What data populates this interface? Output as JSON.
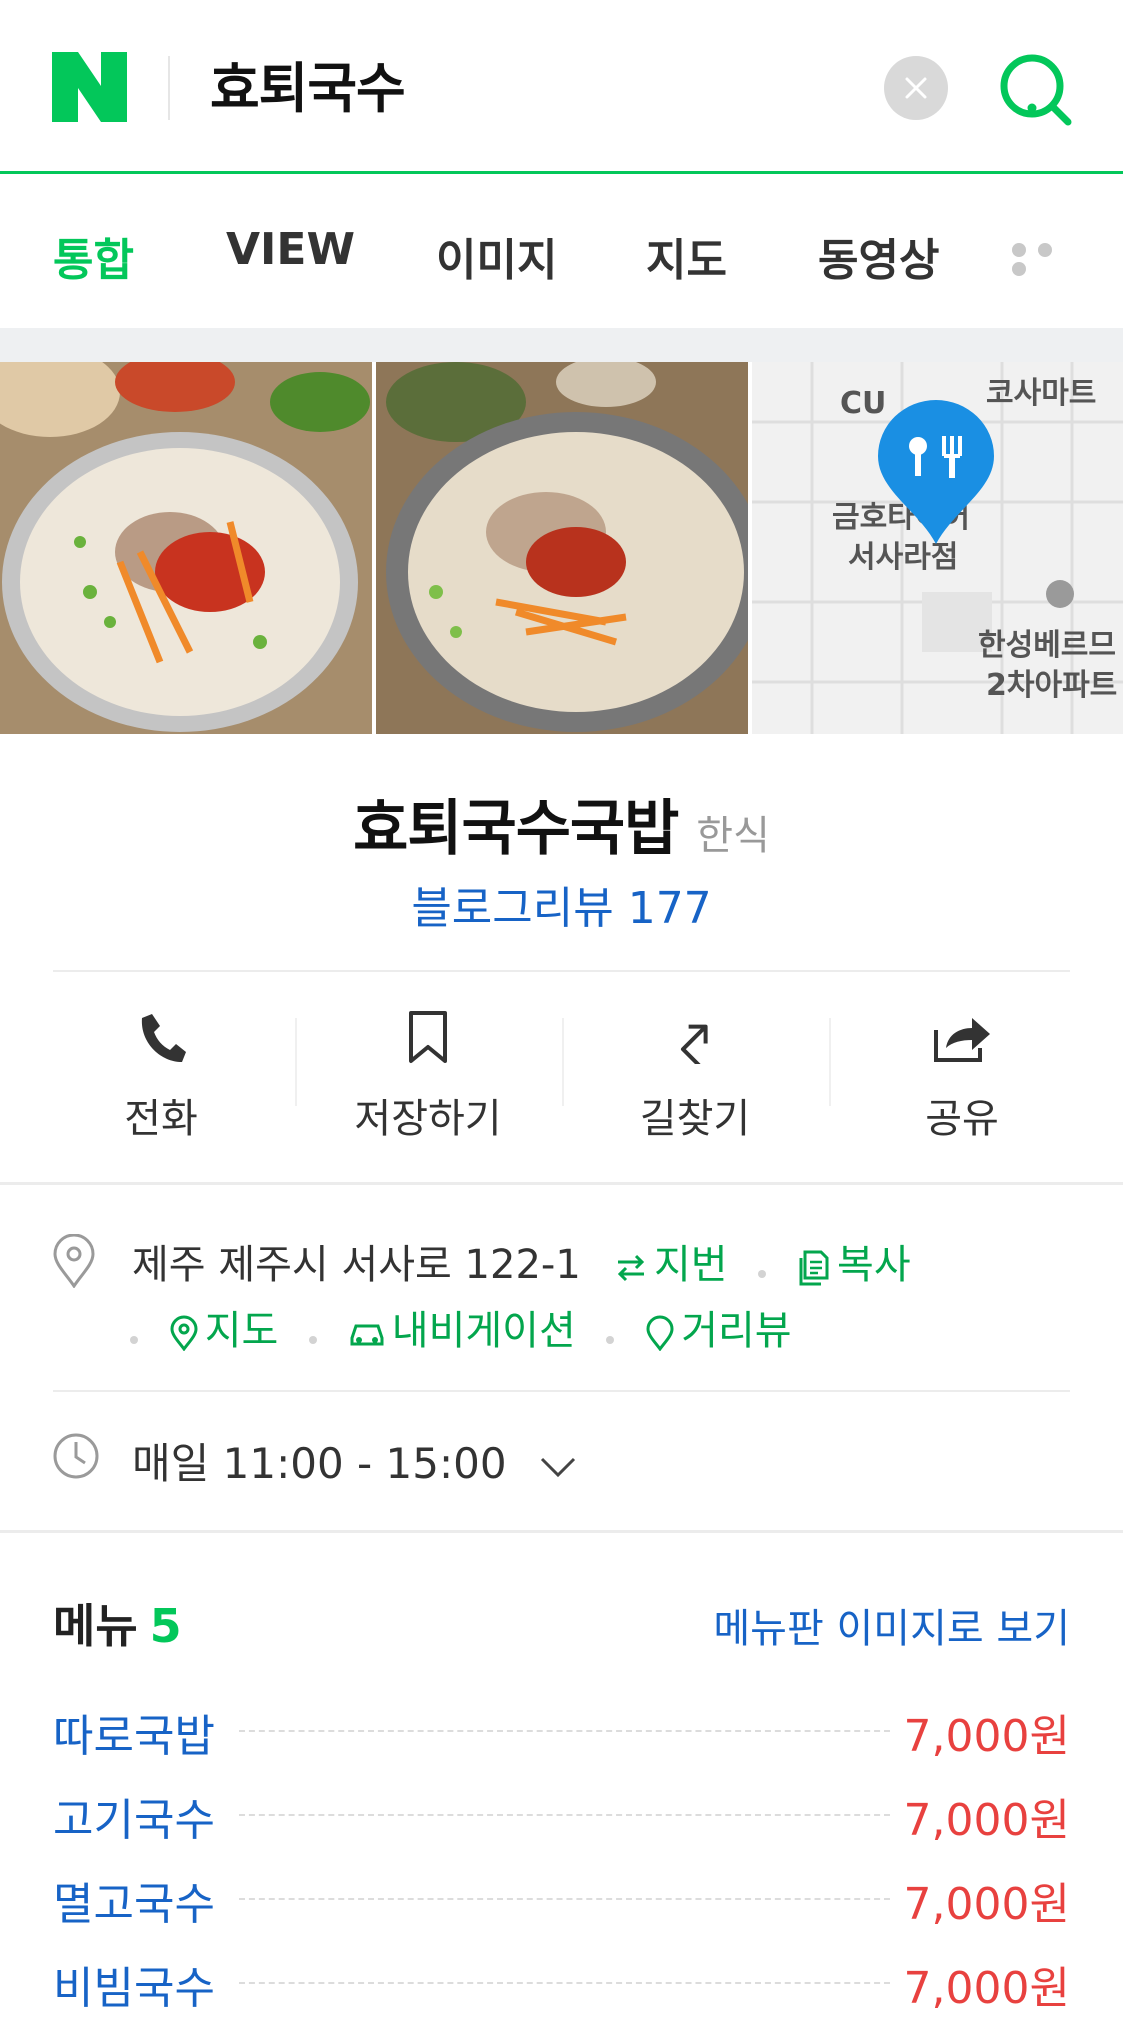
{
  "search": {
    "query": "효퇴국수"
  },
  "tabs": [
    {
      "label": "통합",
      "active": true
    },
    {
      "label": "VIEW",
      "active": false
    },
    {
      "label": "이미지",
      "active": false
    },
    {
      "label": "지도",
      "active": false
    },
    {
      "label": "동영상",
      "active": false
    }
  ],
  "map_labels": {
    "cu": "CU",
    "mart": "코사마트",
    "place_line1": "금호타이어",
    "place_line2": "서사라점",
    "apt_line1": "한성베르므",
    "apt_line2": "2차아파트"
  },
  "place": {
    "name": "효퇴국수국밥",
    "category": "한식",
    "review": "블로그리뷰 177"
  },
  "actions": [
    {
      "label": "전화",
      "icon": "phone-icon"
    },
    {
      "label": "저장하기",
      "icon": "bookmark-icon"
    },
    {
      "label": "길찾기",
      "icon": "directions-icon"
    },
    {
      "label": "공유",
      "icon": "share-icon"
    }
  ],
  "address": {
    "text": "제주 제주시 서사로 122-1",
    "jibun": "지번",
    "copy": "복사",
    "map": "지도",
    "navigation": "내비게이션",
    "streetview": "거리뷰"
  },
  "hours": {
    "text": "매일 11:00 - 15:00"
  },
  "menu": {
    "title": "메뉴",
    "count": "5",
    "image_link": "메뉴판 이미지로 보기",
    "items": [
      {
        "name": "따로국밥",
        "price": "7,000원"
      },
      {
        "name": "고기국수",
        "price": "7,000원"
      },
      {
        "name": "멸고국수",
        "price": "7,000원"
      },
      {
        "name": "비빔국수",
        "price": "7,000원"
      }
    ]
  },
  "colors": {
    "brand_green": "#03c75a",
    "link_blue": "#1763c6",
    "price_red": "#e8413f",
    "map_pin_blue": "#1a8fe3"
  }
}
